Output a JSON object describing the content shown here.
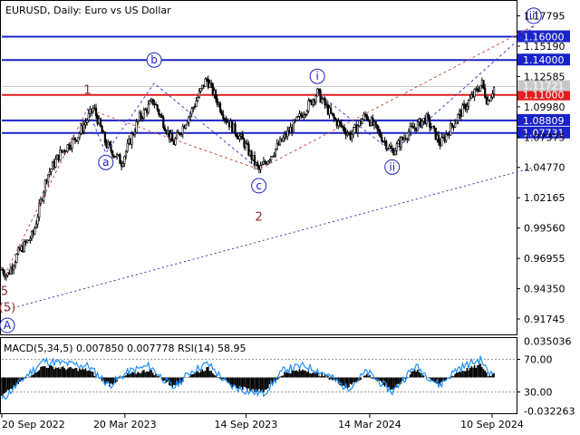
{
  "header": {
    "title": "EURUSD, Daily:  Euro vs US Dollar"
  },
  "chart_data": [
    {
      "type": "candlestick",
      "symbol": "EURUSD",
      "timeframe": "Daily",
      "title": "EURUSD, Daily:  Euro vs US Dollar",
      "ylim": [
        0.905,
        1.19
      ],
      "price_ticks": [
        "1.17795",
        "1.15190",
        "1.12585",
        "1.09980",
        "1.07375",
        "1.04770",
        "1.02165",
        "0.99560",
        "0.96955",
        "0.94350",
        "0.91745"
      ],
      "time_labels": [
        "20 Sep 2022",
        "20 Mar 2023",
        "14 Sep 2023",
        "14 Mar 2024",
        "10 Sep 2024"
      ],
      "current_price": "1.11721",
      "levels": [
        {
          "label": "1.16000",
          "value": 1.16,
          "color": "#1a23c8"
        },
        {
          "label": "1.14000",
          "value": 1.14,
          "color": "#1a23c8"
        },
        {
          "label": "1.11000",
          "value": 1.11,
          "color": "#e02020"
        },
        {
          "label": "1.08809",
          "value": 1.08809,
          "color": "#1a23c8"
        },
        {
          "label": "1.07731",
          "value": 1.07731,
          "color": "#1a23c8"
        }
      ],
      "price_path": [
        {
          "date": "2022-09-20",
          "price": 0.96
        },
        {
          "date": "2022-09-28",
          "price": 0.955
        },
        {
          "date": "2022-10-15",
          "price": 0.975
        },
        {
          "date": "2022-11-05",
          "price": 0.99
        },
        {
          "date": "2022-11-25",
          "price": 1.04
        },
        {
          "date": "2022-12-15",
          "price": 1.06
        },
        {
          "date": "2023-01-10",
          "price": 1.075
        },
        {
          "date": "2023-02-02",
          "price": 1.099
        },
        {
          "date": "2023-02-20",
          "price": 1.068
        },
        {
          "date": "2023-03-15",
          "price": 1.052
        },
        {
          "date": "2023-04-10",
          "price": 1.09
        },
        {
          "date": "2023-05-01",
          "price": 1.105
        },
        {
          "date": "2023-05-30",
          "price": 1.068
        },
        {
          "date": "2023-06-25",
          "price": 1.095
        },
        {
          "date": "2023-07-18",
          "price": 1.124
        },
        {
          "date": "2023-08-15",
          "price": 1.09
        },
        {
          "date": "2023-09-10",
          "price": 1.07
        },
        {
          "date": "2023-10-03",
          "price": 1.045
        },
        {
          "date": "2023-11-05",
          "price": 1.07
        },
        {
          "date": "2023-12-01",
          "price": 1.09
        },
        {
          "date": "2023-12-28",
          "price": 1.112
        },
        {
          "date": "2024-01-20",
          "price": 1.09
        },
        {
          "date": "2024-02-15",
          "price": 1.075
        },
        {
          "date": "2024-03-08",
          "price": 1.093
        },
        {
          "date": "2024-04-16",
          "price": 1.061
        },
        {
          "date": "2024-05-10",
          "price": 1.078
        },
        {
          "date": "2024-06-05",
          "price": 1.09
        },
        {
          "date": "2024-06-26",
          "price": 1.068
        },
        {
          "date": "2024-07-20",
          "price": 1.09
        },
        {
          "date": "2024-08-26",
          "price": 1.12
        },
        {
          "date": "2024-09-03",
          "price": 1.104
        },
        {
          "date": "2024-09-14",
          "price": 1.118
        }
      ],
      "wave_labels": [
        {
          "text": "5",
          "kind": "number",
          "date": "2022-09-24",
          "price": 0.942
        },
        {
          "text": "(5)",
          "kind": "paren",
          "date": "2022-09-28",
          "price": 0.928
        },
        {
          "text": "A",
          "kind": "circle",
          "date": "2022-09-28",
          "price": 0.912
        },
        {
          "text": "1",
          "kind": "number",
          "date": "2023-01-24",
          "price": 1.115
        },
        {
          "text": "a",
          "kind": "circle",
          "date": "2023-02-20",
          "price": 1.052
        },
        {
          "text": "b",
          "kind": "circle",
          "date": "2023-05-02",
          "price": 1.14
        },
        {
          "text": "c",
          "kind": "circle",
          "date": "2023-10-03",
          "price": 1.032
        },
        {
          "text": "2",
          "kind": "number",
          "date": "2023-10-03",
          "price": 1.006
        },
        {
          "text": "i",
          "kind": "circle",
          "date": "2023-12-28",
          "price": 1.126
        },
        {
          "text": "ii",
          "kind": "circle",
          "date": "2024-04-16",
          "price": 1.048
        },
        {
          "text": "iii",
          "kind": "circle",
          "date": "2024-11-10",
          "price": 1.178
        }
      ],
      "wave_lines": [
        {
          "style": "dashed",
          "color": "#c8524f",
          "points": [
            {
              "date": "2022-09-24",
              "price": 0.955
            },
            {
              "date": "2023-01-24",
              "price": 1.098
            },
            {
              "date": "2023-10-03",
              "price": 1.046
            },
            {
              "date": "2024-11-12",
              "price": 1.17
            }
          ]
        },
        {
          "style": "dashed",
          "color": "#3d43c8",
          "points": [
            {
              "date": "2023-01-24",
              "price": 1.098
            },
            {
              "date": "2023-02-20",
              "price": 1.06
            },
            {
              "date": "2023-05-02",
              "price": 1.12
            },
            {
              "date": "2023-10-03",
              "price": 1.046
            }
          ]
        },
        {
          "style": "dashed",
          "color": "#3d43c8",
          "points": [
            {
              "date": "2023-12-28",
              "price": 1.112
            },
            {
              "date": "2024-04-16",
              "price": 1.061
            },
            {
              "date": "2024-11-12",
              "price": 1.17
            }
          ]
        },
        {
          "style": "dotted",
          "color": "#4b2fa8",
          "points": [
            {
              "date": "2022-09-24",
              "price": 0.925
            },
            {
              "date": "2024-11-12",
              "price": 1.048
            }
          ]
        }
      ]
    },
    {
      "type": "indicator",
      "title": "MACD(5,34,5) 0.007850 0.007778 RSI(14) 58.95",
      "macd_ticks": [
        "0.035036",
        "-0.032263"
      ],
      "rsi_ticks": [
        "70.00",
        "30.00"
      ],
      "macd_range": [
        -0.0335,
        0.037
      ],
      "rsi_range": [
        5,
        95
      ],
      "rsi_path": [
        {
          "date": "2022-09-20",
          "value": 20
        },
        {
          "date": "2022-10-20",
          "value": 45
        },
        {
          "date": "2022-11-20",
          "value": 68
        },
        {
          "date": "2022-12-20",
          "value": 65
        },
        {
          "date": "2023-01-25",
          "value": 62
        },
        {
          "date": "2023-02-25",
          "value": 38
        },
        {
          "date": "2023-03-25",
          "value": 55
        },
        {
          "date": "2023-04-25",
          "value": 62
        },
        {
          "date": "2023-05-30",
          "value": 35
        },
        {
          "date": "2023-06-25",
          "value": 55
        },
        {
          "date": "2023-07-20",
          "value": 65
        },
        {
          "date": "2023-08-20",
          "value": 38
        },
        {
          "date": "2023-09-20",
          "value": 30
        },
        {
          "date": "2023-10-10",
          "value": 28
        },
        {
          "date": "2023-11-10",
          "value": 58
        },
        {
          "date": "2023-12-10",
          "value": 62
        },
        {
          "date": "2024-01-10",
          "value": 52
        },
        {
          "date": "2024-02-10",
          "value": 34
        },
        {
          "date": "2024-03-10",
          "value": 55
        },
        {
          "date": "2024-04-16",
          "value": 30
        },
        {
          "date": "2024-05-20",
          "value": 62
        },
        {
          "date": "2024-06-25",
          "value": 38
        },
        {
          "date": "2024-07-20",
          "value": 58
        },
        {
          "date": "2024-08-25",
          "value": 70
        },
        {
          "date": "2024-09-05",
          "value": 52
        },
        {
          "date": "2024-09-14",
          "value": 58.95
        }
      ]
    }
  ]
}
